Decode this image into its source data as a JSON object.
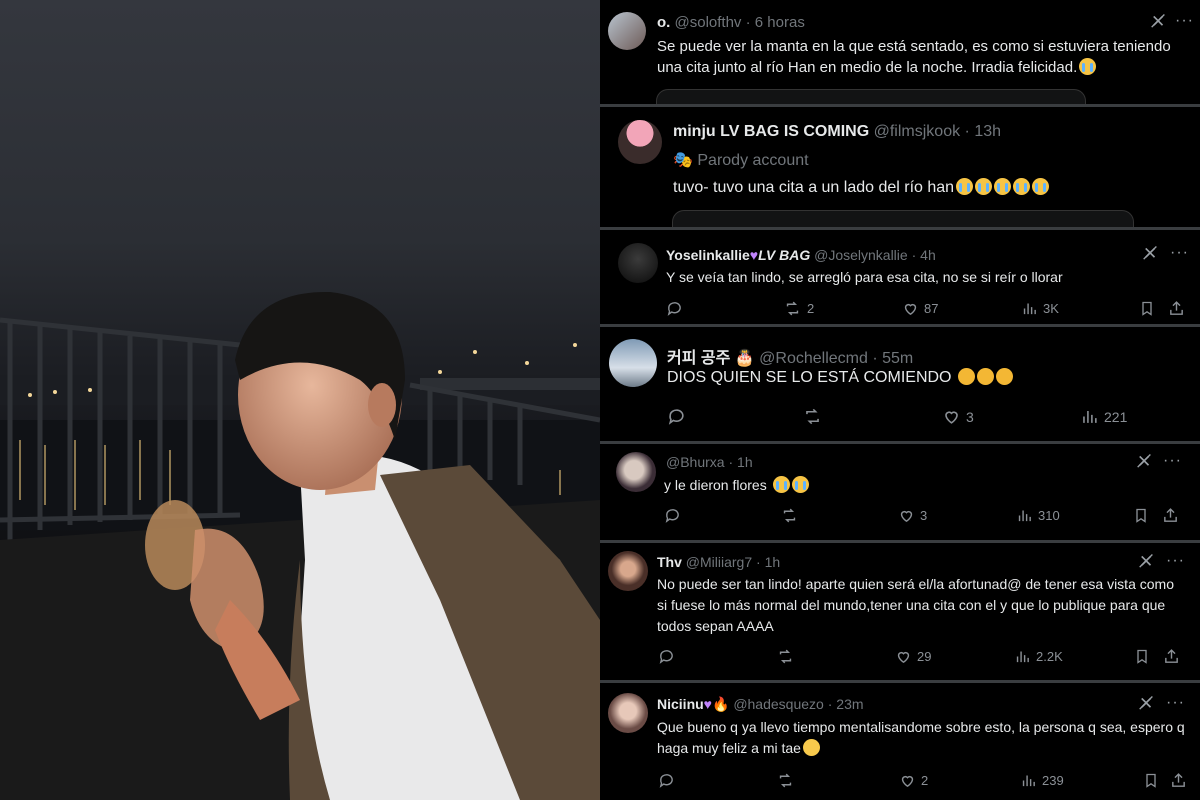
{
  "photo": {
    "description_icon": "photo-icon"
  },
  "tweets": [
    {
      "name": "o.",
      "handle": "@solofthv",
      "time": "6 horas",
      "text": "Se puede ver la manta en la que está sentado, es como si estuviera teniendo una cita junto al río Han en medio de la noche. Irradia felicidad."
    },
    {
      "name": "minju LV BAG IS COMING",
      "handle": "@filmsjkook",
      "time": "13h",
      "label": "Parody account",
      "text": "tuvo- tuvo una cita a un lado del río han"
    },
    {
      "name": "Yoselinkallie",
      "name_suffix": "LV BAG",
      "handle": "@Joselynkallie",
      "time": "4h",
      "text": "Y se veía tan lindo, se arregló para esa cita, no se si reír o llorar",
      "replies": "",
      "reposts": "2",
      "likes": "87",
      "views": "3K"
    },
    {
      "name": "커피 공주",
      "handle": "@Rochellecmd",
      "time": "55m",
      "text": "DIOS QUIEN SE LO ESTÁ COMIENDO",
      "replies": "",
      "reposts": "",
      "likes": "3",
      "views": "221"
    },
    {
      "name": "",
      "handle": "@Bhurxa",
      "time": "1h",
      "text": "y le dieron flores",
      "replies": "",
      "reposts": "",
      "likes": "3",
      "views": "310"
    },
    {
      "name": "Thv",
      "handle": "@Miliiarg7",
      "time": "1h",
      "text": "No puede ser tan lindo! aparte quien será el/la afortunad@ de tener esa vista como si fuese lo más normal del mundo,tener una cita con el y que lo publique para que todos sepan AAAA",
      "replies": "",
      "reposts": "",
      "likes": "29",
      "views": "2.2K"
    },
    {
      "name": "Niciinu",
      "handle": "@hadesquezo",
      "time": "23m",
      "text": "Que bueno q ya llevo tiempo mentalisandome sobre esto, la persona q sea, espero q haga muy feliz a mi tae",
      "replies": "",
      "reposts": "",
      "likes": "2",
      "views": "239"
    }
  ],
  "sep": " · ",
  "colors": {
    "background": "#000000",
    "text": "#e7e9ea",
    "muted": "#71767b",
    "heart": "#c084fc"
  }
}
